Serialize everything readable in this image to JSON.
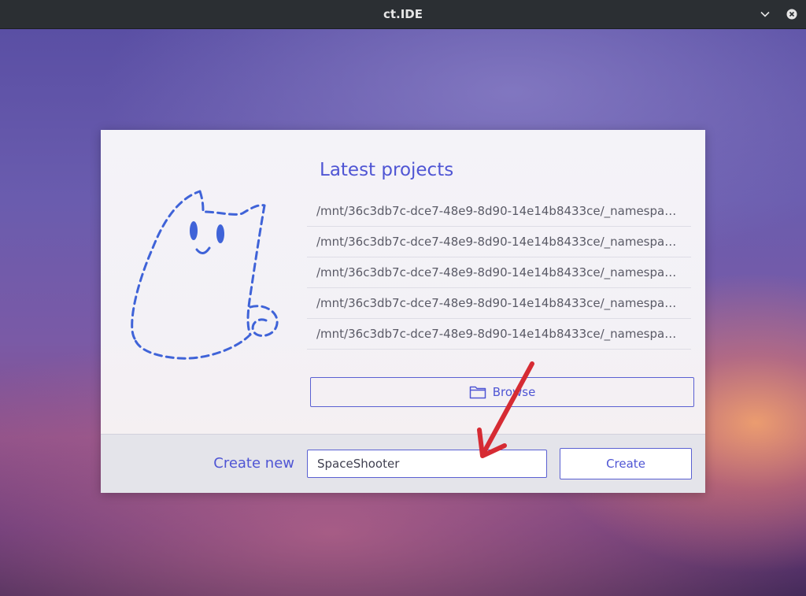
{
  "window": {
    "title": "ct.IDE",
    "controls": [
      "chevron-down-icon",
      "close-icon"
    ]
  },
  "dialog": {
    "latest_heading": "Latest projects",
    "projects": [
      "/mnt/36c3db7c-dce7-48e9-8d90-14e14b8433ce/_namespace...",
      "/mnt/36c3db7c-dce7-48e9-8d90-14e14b8433ce/_namespace...",
      "/mnt/36c3db7c-dce7-48e9-8d90-14e14b8433ce/_namespace...",
      "/mnt/36c3db7c-dce7-48e9-8d90-14e14b8433ce/_namespace...",
      "/mnt/36c3db7c-dce7-48e9-8d90-14e14b8433ce/_namespace..."
    ],
    "browse_label": "Browse",
    "create_new_label": "Create new",
    "project_name_value": "SpaceShooter",
    "create_button_label": "Create"
  },
  "colors": {
    "accent": "#4f55d4",
    "annotation_arrow": "#d62b33"
  }
}
